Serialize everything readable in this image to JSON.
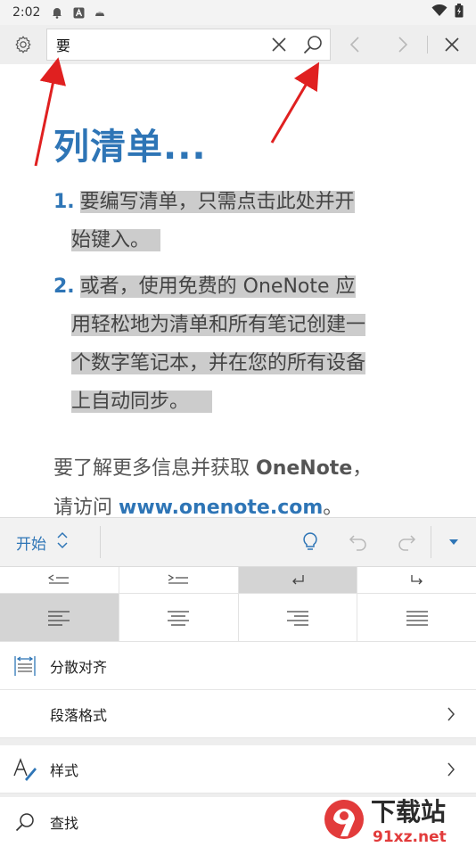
{
  "status_bar": {
    "time": "2:02"
  },
  "find_bar": {
    "query": "要"
  },
  "document": {
    "title": "列清单...",
    "items": [
      {
        "number": "1.",
        "lines": [
          "要编写清单，只需点击此处并开",
          "始键入。"
        ]
      },
      {
        "number": "2.",
        "lines": [
          "或者，使用免费的 OneNote 应",
          "用轻松地为清单和所有笔记创建一",
          "个数字笔记本，并在您的所有设备",
          "上自动同步。"
        ]
      }
    ],
    "paragraph": {
      "line1_prefix": "要了解更多信息并获取 ",
      "line1_bold": "OneNote",
      "line1_suffix": "，",
      "line2_prefix": "请访问 ",
      "line2_link": "www.onenote.com",
      "line2_suffix": "。"
    }
  },
  "ribbon": {
    "tab_label": "开始"
  },
  "panel": {
    "distribute_label": "分散对齐",
    "paragraph_format_label": "段落格式",
    "styles_label": "样式",
    "find_label": "查找"
  },
  "watermark": {
    "text1": "下载站",
    "text2": "91xz.net"
  },
  "colors": {
    "accent": "#2e75b6",
    "highlight": "#cccccc",
    "arrow": "#e02020"
  }
}
